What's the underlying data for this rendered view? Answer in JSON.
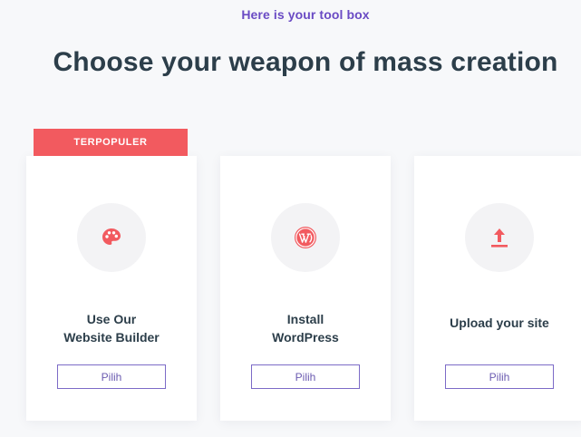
{
  "header": {
    "eyebrow": "Here is your tool box",
    "headline": "Choose your weapon of mass creation"
  },
  "colors": {
    "accent_purple": "#6a4bc4",
    "accent_red": "#f25a5f",
    "heading": "#2c3e4a"
  },
  "cards": [
    {
      "badge": "TERPOPULER",
      "icon": "palette-icon",
      "title": "Use Our\nWebsite Builder",
      "button_label": "Pilih"
    },
    {
      "icon": "wordpress-icon",
      "title": "Install\nWordPress",
      "button_label": "Pilih"
    },
    {
      "icon": "upload-icon",
      "title": "Upload your site",
      "button_label": "Pilih"
    }
  ]
}
